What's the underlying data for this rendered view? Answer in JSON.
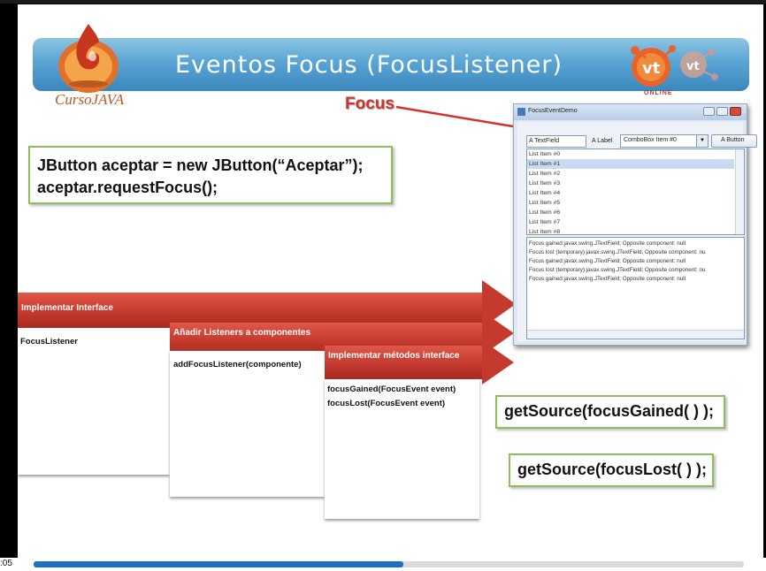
{
  "slide": {
    "title": "Eventos Focus (FocusListener)",
    "logo_text": "CursoJAVA",
    "vt_logo_letters": "vt",
    "vt_online": "ONLINE",
    "focus_label": "Focus",
    "code": {
      "line1": "JButton aceptar = new JButton(“Aceptar”);",
      "line2": "aceptar.requestFocus();"
    },
    "get_source_gained": "getSource(focusGained( ) );",
    "get_source_lost": "getSource(focusLost( ) );",
    "process": [
      {
        "header": "Implementar Interface",
        "body": [
          "FocusListener"
        ]
      },
      {
        "header": "Añadir Listeners a componentes",
        "body": [
          "addFocusListener(componente)"
        ]
      },
      {
        "header": "Implementar métodos interface",
        "body": [
          "focusGained(FocusEvent   event)",
          "focusLost(FocusEvent   event)"
        ]
      }
    ]
  },
  "demo_window": {
    "title": "FocusEventDemo",
    "text_field": "A TextField",
    "label": "A Label",
    "combo_value": "ComboBox Item #0",
    "button": "A Button",
    "list_items": [
      "List Item #0",
      "List Item #1",
      "List Item #2",
      "List Item #3",
      "List Item #4",
      "List Item #5",
      "List Item #6",
      "List Item #7",
      "List Item #8"
    ],
    "selected_index": 1,
    "log_lines": [
      "Focus gained:javax.swing.JTextField; Opposite component: null",
      "Focus lost (temporary):javax.swing.JTextField; Opposite component: nu",
      "Focus gained:javax.swing.JTextField; Opposite component: null",
      "Focus lost (temporary):javax.swing.JTextField; Opposite component: nu",
      "Focus gained:javax.swing.JTextField; Opposite component: null"
    ]
  },
  "player": {
    "time": ":05",
    "progress": 0.52
  },
  "colors": {
    "banner": "#5aa5d4",
    "band_red": "#c43a2e",
    "code_border": "#8cbf5a",
    "focus_red": "#d2322d",
    "progress_fill": "#1f6fc2"
  }
}
